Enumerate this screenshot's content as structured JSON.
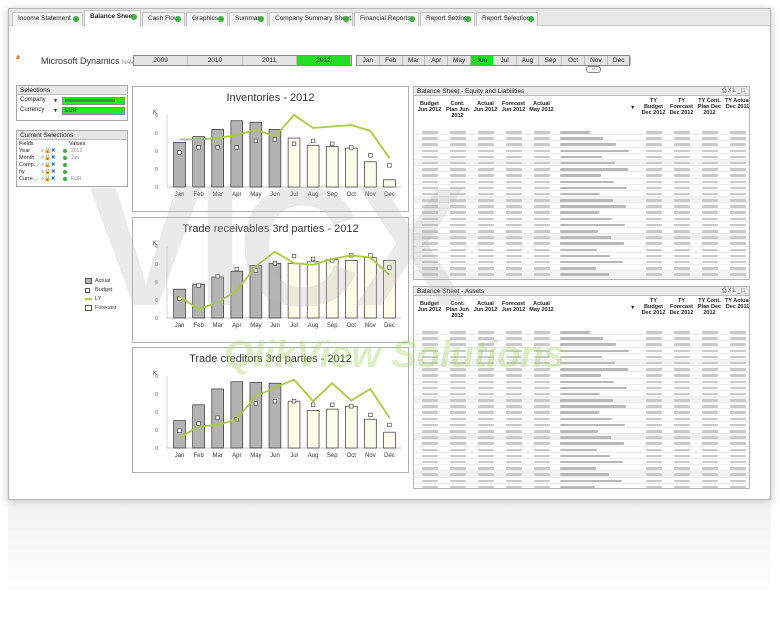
{
  "tabs": [
    {
      "label": "Income Statement",
      "active": false
    },
    {
      "label": "Balance Sheet",
      "active": true
    },
    {
      "label": "Cash Flow",
      "active": false
    },
    {
      "label": "Graphics",
      "active": false
    },
    {
      "label": "Summary",
      "active": false
    },
    {
      "label": "Company Summary Sheet",
      "active": false
    },
    {
      "label": "Financial Reports",
      "active": false
    },
    {
      "label": "Report Settings",
      "active": false
    },
    {
      "label": "Report Selections",
      "active": false
    }
  ],
  "brand": {
    "name": "Microsoft Dynamics",
    "suffix": "NAV"
  },
  "years": [
    "2009",
    "2010",
    "2011",
    "2012"
  ],
  "selected_year": "2012",
  "months": [
    "Jan",
    "Feb",
    "Mar",
    "Apr",
    "May",
    "Jun",
    "Jul",
    "Aug",
    "Sep",
    "Oct",
    "Nov",
    "Dec"
  ],
  "selected_month": "Jun",
  "selections": {
    "title": "Selections",
    "company_label": "Company",
    "currency_label": "Currency",
    "currency_value": "EUR"
  },
  "current_selections": {
    "title": "Current Selections",
    "fields_header": "Fields",
    "values_header": "Values",
    "rows": [
      {
        "field": "Year",
        "value": "2012"
      },
      {
        "field": "Month",
        "value": "Jun"
      },
      {
        "field": "Comp...",
        "value": ""
      },
      {
        "field": "ny",
        "value": ""
      },
      {
        "field": "Curre...",
        "value": "EUR"
      }
    ]
  },
  "legend": {
    "actual": "Actual",
    "budget": "Budget",
    "ly": "LY",
    "forecast": "Forecast"
  },
  "colors": {
    "actual": "#b3b3b3",
    "forecast": "#fcfcea",
    "ly": "#a9cc3a",
    "selected": "#22dd22"
  },
  "charts": [
    {
      "title": "Inventories - 2012",
      "unit": "K"
    },
    {
      "title": "Trade receivables 3rd parties - 2012",
      "unit": "K"
    },
    {
      "title": "Trade creditors 3rd parties - 2012",
      "unit": "K"
    }
  ],
  "chart_data": [
    {
      "type": "bar",
      "title": "Inventories - 2012",
      "categories": [
        "Jan",
        "Feb",
        "Mar",
        "Apr",
        "May",
        "Jun",
        "Jul",
        "Aug",
        "Sep",
        "Oct",
        "Nov",
        "Dec"
      ],
      "series": [
        {
          "name": "Actual",
          "values": [
            0.62,
            0.7,
            0.8,
            0.92,
            0.9,
            0.8,
            null,
            null,
            null,
            null,
            null,
            null
          ]
        },
        {
          "name": "Forecast",
          "values": [
            null,
            null,
            null,
            null,
            null,
            null,
            0.68,
            0.58,
            0.56,
            0.54,
            0.35,
            0.1
          ]
        },
        {
          "name": "Budget",
          "values": [
            0.48,
            0.55,
            0.55,
            0.55,
            0.64,
            0.66,
            0.6,
            0.64,
            0.6,
            0.55,
            0.44,
            0.3
          ]
        },
        {
          "name": "LY",
          "values": [
            0.66,
            0.66,
            0.68,
            0.72,
            0.8,
            0.7,
            1.0,
            0.82,
            0.84,
            0.86,
            0.78,
            0.4
          ]
        }
      ]
    },
    {
      "type": "bar",
      "title": "Trade receivables 3rd parties - 2012",
      "categories": [
        "Jan",
        "Feb",
        "Mar",
        "Apr",
        "May",
        "Jun",
        "Jul",
        "Aug",
        "Sep",
        "Oct",
        "Nov",
        "Dec"
      ],
      "series": [
        {
          "name": "Actual",
          "values": [
            0.4,
            0.47,
            0.57,
            0.65,
            0.73,
            0.76,
            null,
            null,
            null,
            null,
            null,
            null
          ]
        },
        {
          "name": "Forecast",
          "values": [
            null,
            null,
            null,
            null,
            null,
            null,
            0.76,
            0.78,
            0.81,
            0.8,
            0.84,
            0.8
          ]
        },
        {
          "name": "Budget",
          "values": [
            0.27,
            0.45,
            0.58,
            0.68,
            0.66,
            0.76,
            0.86,
            0.82,
            0.8,
            0.87,
            0.87,
            0.7
          ]
        },
        {
          "name": "LY",
          "values": [
            0.3,
            0.12,
            0.22,
            0.38,
            0.72,
            0.92,
            0.76,
            0.74,
            0.82,
            0.87,
            0.84,
            0.6
          ]
        }
      ]
    },
    {
      "type": "bar",
      "title": "Trade creditors 3rd parties - 2012",
      "categories": [
        "Jan",
        "Feb",
        "Mar",
        "Apr",
        "May",
        "Jun",
        "Jul",
        "Aug",
        "Sep",
        "Oct",
        "Nov",
        "Dec"
      ],
      "series": [
        {
          "name": "Actual",
          "values": [
            0.38,
            0.6,
            0.82,
            0.92,
            0.91,
            0.9,
            null,
            null,
            null,
            null,
            null,
            null
          ]
        },
        {
          "name": "Forecast",
          "values": [
            null,
            null,
            null,
            null,
            null,
            null,
            0.65,
            0.52,
            0.54,
            0.58,
            0.4,
            0.22
          ]
        },
        {
          "name": "Budget",
          "values": [
            0.24,
            0.34,
            0.42,
            0.4,
            0.62,
            0.65,
            0.65,
            0.6,
            0.6,
            0.58,
            0.46,
            0.32
          ]
        },
        {
          "name": "LY",
          "values": [
            0.14,
            0.3,
            0.32,
            0.4,
            0.72,
            0.84,
            0.95,
            0.65,
            0.9,
            0.66,
            0.82,
            0.42
          ]
        }
      ]
    }
  ],
  "equity_table": {
    "title": "Balance Sheet - Equity and Liabilities",
    "headers": [
      "Budget Jun 2012",
      "Cont. Plan Jun 2012",
      "Actual Jun 2012",
      "Forecast Jun 2012",
      "Actual May 2012",
      "",
      "TY Budget Dec 2012",
      "TY Forecast Dec 2012",
      "TY Cont. Plan Dec 2012",
      "TY Actual Dec 2011"
    ],
    "row_count": 24
  },
  "assets_table": {
    "title": "Balance Sheet - Assets",
    "headers": [
      "Budget Jun 2012",
      "Cont. Plan Jun 2012",
      "Actual Jun 2012",
      "Forecast Jun 2012",
      "Actual May 2012",
      "",
      "TY Budget Dec 2012",
      "TY Forecast Dec 2012",
      "TY Cont. Plan Dec 2012",
      "TY Actual Dec 2011"
    ],
    "row_count": 27
  },
  "watermark": {
    "big": "VICX",
    "small": "QlikView Solutions"
  }
}
